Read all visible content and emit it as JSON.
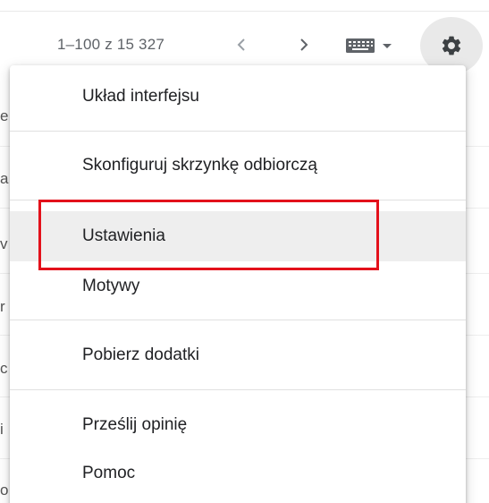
{
  "toolbar": {
    "page_count": "1–100 z 15 327",
    "prev_icon": "chevron-left-icon",
    "next_icon": "chevron-right-icon",
    "keyboard_icon": "keyboard-icon",
    "settings_icon": "gear-icon"
  },
  "background_rows": [
    "e",
    "a",
    "v",
    "r",
    "c",
    "i",
    "o"
  ],
  "menu": {
    "items": [
      {
        "label": "Układ interfejsu"
      },
      {
        "label": "Skonfiguruj skrzynkę odbiorczą"
      },
      {
        "label": "Ustawienia"
      },
      {
        "label": "Motywy"
      },
      {
        "label": "Pobierz dodatki"
      },
      {
        "label": "Prześlij opinię"
      },
      {
        "label": "Pomoc"
      }
    ]
  },
  "colors": {
    "highlight_box": "#e3111b",
    "menu_hover": "#eeeeee",
    "settings_bg": "#e9e9e9"
  }
}
